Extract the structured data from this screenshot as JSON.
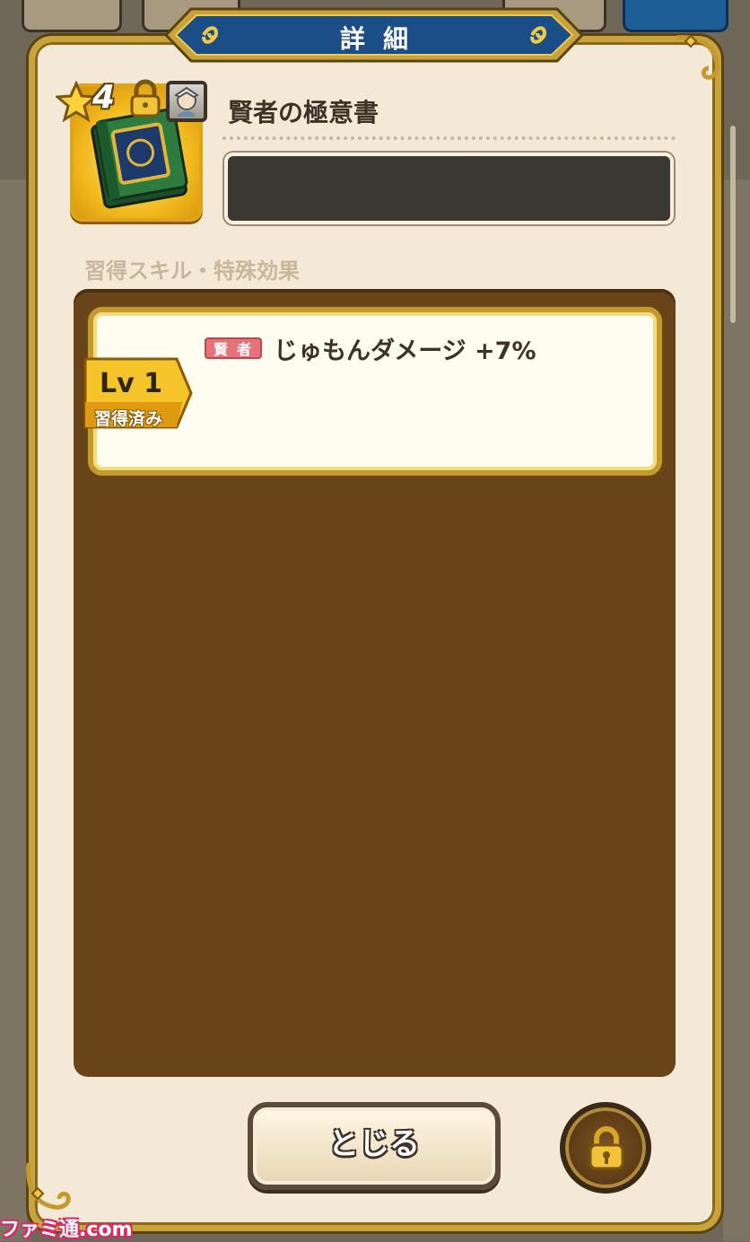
{
  "header": {
    "title": "詳細"
  },
  "item": {
    "rarity": "4",
    "name": "賢者の極意書",
    "description": ""
  },
  "section": {
    "label": "習得スキル・特殊効果"
  },
  "skills": [
    {
      "job_badge": "賢者",
      "effect": "じゅもんダメージ +7%",
      "level": "Lv 1",
      "status": "習得済み"
    }
  ],
  "buttons": {
    "close_label": "とじる"
  },
  "watermark": "ファミ通.com",
  "colors": {
    "panel_bg": "#f3e9d6",
    "frame_gold": "#c9a43c",
    "header_blue": "#1b4e86",
    "skills_bg": "#684418",
    "badge_red": "#e7737a"
  }
}
